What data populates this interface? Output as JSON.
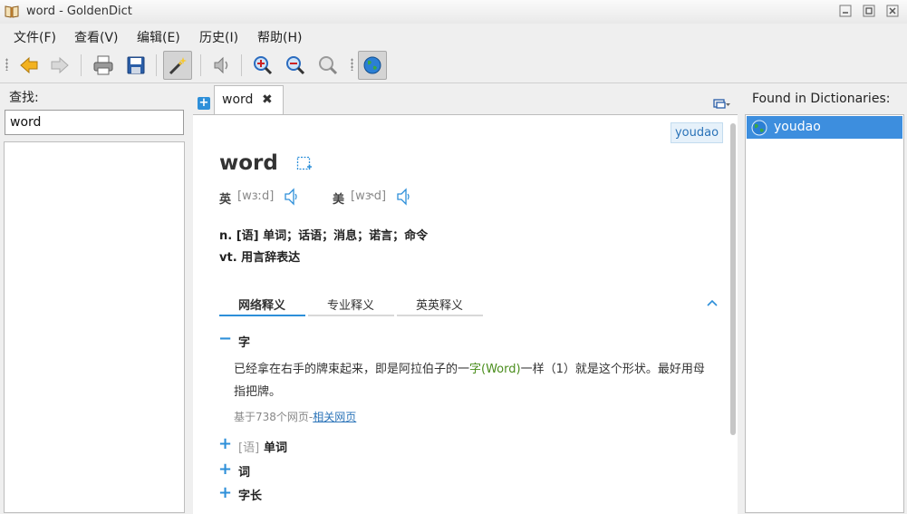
{
  "window": {
    "title": "word - GoldenDict"
  },
  "menu": {
    "items": [
      "文件(F)",
      "查看(V)",
      "编辑(E)",
      "历史(I)",
      "帮助(H)"
    ]
  },
  "toolbar": {
    "buttons": [
      "back-icon",
      "forward-icon",
      "print-icon",
      "save-icon",
      "scan-popup-icon",
      "pronounce-icon",
      "zoom-in-icon",
      "zoom-out-icon",
      "zoom-reset-icon",
      "web-icon"
    ]
  },
  "left_panel": {
    "label": "查找:",
    "search_value": "word"
  },
  "tabs": [
    {
      "label": "word",
      "close": "✖"
    }
  ],
  "article": {
    "dict_badge": "youdao",
    "headword": "word",
    "pronunciations": [
      {
        "label": "英",
        "phonetic": "[wɜːd]"
      },
      {
        "label": "美",
        "phonetic": "[wɝd]"
      }
    ],
    "definitions": [
      "n. [语] 单词；话语；消息；诺言；命令",
      "vt. 用言辞表达"
    ],
    "sub_tabs": [
      "网络释义",
      "专业释义",
      "英英释义"
    ],
    "expanded_sense": {
      "marker": "−",
      "title": "字",
      "text_before": "已经拿在右手的牌束起来，即是阿拉伯子的一",
      "text_highlight": "字(Word)",
      "text_after": "一样（1）就是这个形状。最好用母指把牌。",
      "source_prefix": "基于738个网页-",
      "source_link": "相关网页"
    },
    "collapsed_senses": [
      {
        "marker": "+",
        "prefix": "[语]",
        "title": "单词"
      },
      {
        "marker": "+",
        "prefix": "",
        "title": "词"
      },
      {
        "marker": "+",
        "prefix": "",
        "title": "字长"
      }
    ]
  },
  "right_panel": {
    "label": "Found in Dictionaries:",
    "dictionaries": [
      "youdao"
    ]
  },
  "colors": {
    "accent": "#2d8fd9",
    "selection": "#3d8ede",
    "highlight_text": "#4a8d1c"
  }
}
